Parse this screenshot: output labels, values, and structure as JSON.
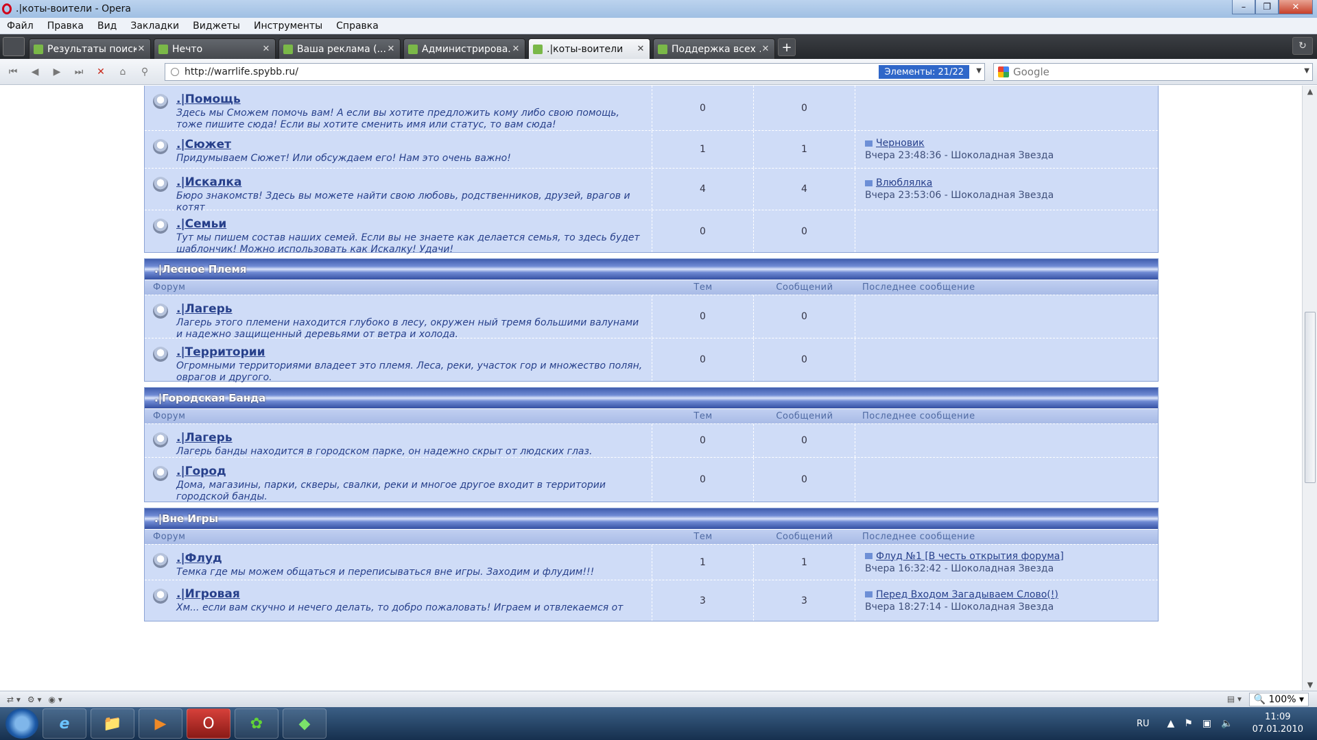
{
  "window": {
    "title": ".|коты-воители - Opera"
  },
  "menu": [
    "Файл",
    "Правка",
    "Вид",
    "Закладки",
    "Виджеты",
    "Инструменты",
    "Справка"
  ],
  "tabs": [
    {
      "title": "Результаты поиск...",
      "active": false
    },
    {
      "title": "Нечто",
      "active": false
    },
    {
      "title": "Ваша реклама (...:...",
      "active": false
    },
    {
      "title": "Администрирова...",
      "active": false
    },
    {
      "title": ".|коты-воители",
      "active": true
    },
    {
      "title": "Поддержка всех ...",
      "active": false
    }
  ],
  "address": {
    "url": "http://warrlife.spybb.ru/",
    "elements_label": "Элементы:  21/22",
    "search_placeholder": "Google"
  },
  "columns": {
    "forum": "Форум",
    "topics": "Тем",
    "posts": "Сообщений",
    "last": "Последнее сообщение"
  },
  "categories": [
    {
      "name": "",
      "show_header": false,
      "forums": [
        {
          "title": ".|Помощь",
          "desc": "Здесь мы Сможем помочь вам! А если вы хотите предложить кому либо свою помощь, тоже пишите сюда! Если вы хотите сменить имя или статус, то вам сюда!",
          "topics": "0",
          "posts": "0",
          "last_topic": "",
          "last_meta": ""
        },
        {
          "title": ".|Сюжет",
          "desc": "Придумываем Сюжет! Или обсуждаем его! Нам это очень важно!",
          "topics": "1",
          "posts": "1",
          "last_topic": "Черновик",
          "last_meta": "Вчера 23:48:36 - Шоколадная Звезда"
        },
        {
          "title": ".|Искалка",
          "desc": "Бюро знакомств! Здесь вы можете найти свою любовь, родственников, друзей, врагов и котят",
          "topics": "4",
          "posts": "4",
          "last_topic": "Влюблялка",
          "last_meta": "Вчера 23:53:06 - Шоколадная Звезда"
        },
        {
          "title": ".|Семьи",
          "desc": "Тут мы пишем состав наших семей. Если вы не знаете как делается семья, то здесь будет шаблончик! Можно использовать как Искалку! Удачи!",
          "topics": "0",
          "posts": "0",
          "last_topic": "",
          "last_meta": ""
        }
      ]
    },
    {
      "name": ".|Лесное Племя",
      "show_header": true,
      "forums": [
        {
          "title": ".|Лагерь",
          "desc": "Лагерь этого племени находится глубоко в лесу, окружен ный тремя большими валунами и надежно защищенный деревьями от ветра и холода.",
          "topics": "0",
          "posts": "0",
          "last_topic": "",
          "last_meta": ""
        },
        {
          "title": ".|Территории",
          "desc": "Огромными территориями владеет это племя. Леса, реки, участок гор и множество полян, оврагов и другого.",
          "topics": "0",
          "posts": "0",
          "last_topic": "",
          "last_meta": ""
        }
      ]
    },
    {
      "name": ".|Городская Банда",
      "show_header": true,
      "forums": [
        {
          "title": ".|Лагерь",
          "desc": "Лагерь банды находится в городском парке, он надежно скрыт от людских глаз.",
          "topics": "0",
          "posts": "0",
          "last_topic": "",
          "last_meta": ""
        },
        {
          "title": ".|Город",
          "desc": "Дома, магазины, парки, скверы, свалки, реки и многое другое входит в территории городской банды.",
          "topics": "0",
          "posts": "0",
          "last_topic": "",
          "last_meta": ""
        }
      ]
    },
    {
      "name": ".|Вне Игры",
      "show_header": true,
      "forums": [
        {
          "title": ".|Флуд",
          "desc": "Темка где мы можем общаться и переписываться вне игры. Заходим и флудим!!!",
          "topics": "1",
          "posts": "1",
          "last_topic": "Флуд №1 [В честь открытия форума]",
          "last_meta": "Вчера 16:32:42 - Шоколадная Звезда"
        },
        {
          "title": ".|Игровая",
          "desc": "Хм... если вам скучно и нечего делать, то добро пожаловать! Играем и отвлекаемся от",
          "topics": "3",
          "posts": "3",
          "last_topic": "Перед Входом Загадываем Слово(!)",
          "last_meta": "Вчера 18:27:14 - Шоколадная Звезда"
        }
      ]
    }
  ],
  "status": {
    "zoom": "100%"
  },
  "taskbar": {
    "lang": "RU",
    "time": "11:09",
    "date": "07.01.2010"
  }
}
